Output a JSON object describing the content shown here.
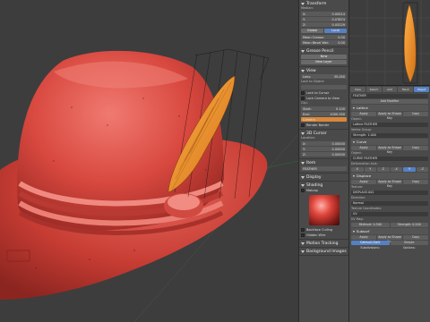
{
  "npanel": {
    "transform_title": "Transform",
    "median_label": "Median:",
    "x": "X:",
    "x_val": "0.00014",
    "y": "Y:",
    "y_val": "0.07874",
    "z": "Z:",
    "z_val": "0.05229",
    "global": "Global",
    "local": "Local",
    "mean_crease_label": "Mean Crease:",
    "mean_crease_val": "0.00",
    "mean_bevel_label": "Mean Bevel Wei:",
    "mean_bevel_val": "0.00",
    "grease_pencil_title": "Grease Pencil",
    "new_btn": "New",
    "new_layer_btn": "New Layer",
    "view_title": "View",
    "lens_label": "Lens:",
    "lens_val": "35.000",
    "lock_object_label": "Lock to Object:",
    "lock_cursor": "Lock to Cursor",
    "lock_camera": "Lock Camera to View",
    "clip_label": "Clip:",
    "start_label": "Start:",
    "start_val": "0.100",
    "end_label": "End:",
    "end_val": "1000.000",
    "camera_label": "Camera",
    "render_border": "Render Border",
    "cursor_title": "3D Cursor",
    "location_label": "Location:",
    "cx": "X:",
    "cx_val": "0.00000",
    "cy": "Y:",
    "cy_val": "0.00000",
    "cz": "Z:",
    "cz_val": "0.00000",
    "item_title": "Item",
    "item_name": "FEATHER",
    "display_title": "Display",
    "shading_title": "Shading",
    "matcap_label": "Matcap",
    "backface_culling": "Backface Culling",
    "hidden_wire": "Hidden Wire",
    "motion_tracking_title": "Motion Tracking",
    "bg_images_title": "Background Images"
  },
  "props": {
    "tabs": [
      "View",
      "Select",
      "Add",
      "Mesh",
      "Object"
    ],
    "object_name": "FEATHER",
    "add_modifier": "Add Modifier",
    "lattice_name": "Lattice",
    "apply": "Apply",
    "apply_shape": "Apply as Shape Key",
    "copy": "Copy",
    "object_label": "Object:",
    "lattice_object": "Lattice FEATHER",
    "vertex_group_label": "Vertex Group:",
    "strength_label": "Strength:",
    "strength_val": "1.000",
    "curve_name": "Curve",
    "curve_object": "CURVE FEATHER",
    "deformation_label": "Deformation Axis:",
    "axes": [
      "X",
      "Y",
      "Z",
      "-X",
      "-Y",
      "-Z"
    ],
    "displace_name": "Displace",
    "texture_label": "Texture:",
    "texture_val": "DISPLACE.002",
    "direction_label": "Direction:",
    "direction_val": "Normal",
    "texture_coords_label": "Texture Coordinates:",
    "texture_coords_val": "UV",
    "uv_map_label": "UV Map:",
    "midlevel_label": "Midlevel:",
    "midlevel_val": "0.500",
    "disp_strength_label": "Strength:",
    "disp_strength_val": "0.200",
    "subsurf_name": "Subsurf",
    "catmull_clark": "Catmull-Clark",
    "simple": "Simple",
    "subdivisions_label": "Subdivisions:",
    "options_label": "Options:"
  }
}
